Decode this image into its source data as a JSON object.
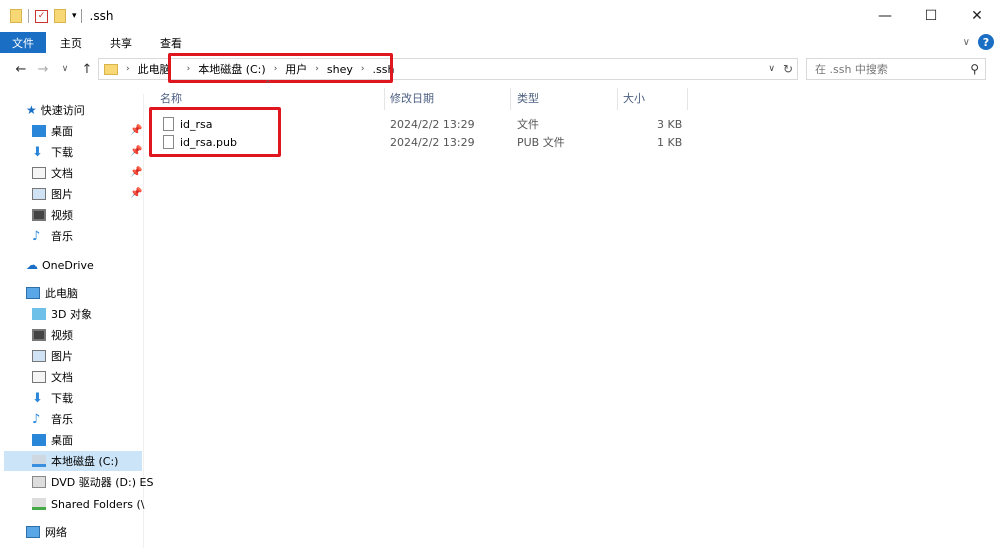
{
  "window": {
    "title": ".ssh"
  },
  "title_controls": {
    "minimize": "—",
    "maximize": "☐",
    "close": "✕"
  },
  "ribbon": {
    "file": "文件",
    "home": "主页",
    "share": "共享",
    "view": "查看",
    "collapse": "∨",
    "help": "?"
  },
  "nav": {
    "back": "←",
    "forward": "→",
    "recent": "∨",
    "up": "↑"
  },
  "breadcrumb": [
    "此电脑",
    "本地磁盘 (C:)",
    "用户",
    "shey",
    ".ssh"
  ],
  "search": {
    "placeholder": "在 .ssh 中搜索"
  },
  "columns": {
    "name": "名称",
    "date": "修改日期",
    "type": "类型",
    "size": "大小"
  },
  "files": [
    {
      "name": "id_rsa",
      "date": "2024/2/2 13:29",
      "type": "文件",
      "size": "3 KB"
    },
    {
      "name": "id_rsa.pub",
      "date": "2024/2/2 13:29",
      "type": "PUB 文件",
      "size": "1 KB"
    }
  ],
  "sidebar": {
    "quick_access": "快速访问",
    "quick_items": [
      "桌面",
      "下载",
      "文档",
      "图片",
      "视频",
      "音乐"
    ],
    "onedrive": "OneDrive",
    "this_pc": "此电脑",
    "pc_items": [
      "3D 对象",
      "视频",
      "图片",
      "文档",
      "下载",
      "音乐",
      "桌面",
      "本地磁盘 (C:)",
      "DVD 驱动器 (D:) ES",
      "Shared Folders (\\"
    ],
    "network": "网络"
  },
  "colors": {
    "accent": "#1a6fc4",
    "highlight": "#e0161e",
    "selected": "#cce4f7"
  }
}
